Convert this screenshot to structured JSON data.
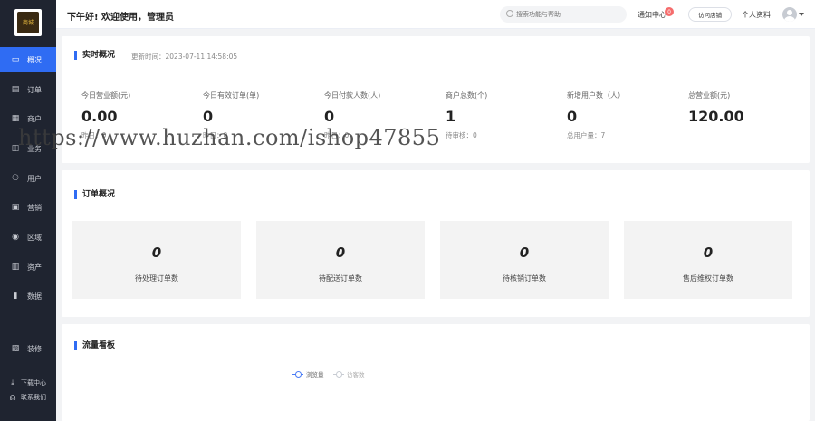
{
  "logo": {
    "text": "商城"
  },
  "sidebar": {
    "items": [
      {
        "label": "概况",
        "icon": "monitor-icon",
        "glyph": "▭"
      },
      {
        "label": "订单",
        "icon": "order-icon",
        "glyph": "▤"
      },
      {
        "label": "商户",
        "icon": "shop-icon",
        "glyph": "▦"
      },
      {
        "label": "业务",
        "icon": "business-icon",
        "glyph": "◫"
      },
      {
        "label": "用户",
        "icon": "user-icon",
        "glyph": "⚇"
      },
      {
        "label": "营销",
        "icon": "marketing-icon",
        "glyph": "▣"
      },
      {
        "label": "区域",
        "icon": "region-icon",
        "glyph": "◉"
      },
      {
        "label": "资产",
        "icon": "asset-icon",
        "glyph": "▥"
      },
      {
        "label": "数据",
        "icon": "data-icon",
        "glyph": "▮"
      },
      {
        "label": "装修",
        "icon": "decorate-icon",
        "glyph": "▧"
      }
    ],
    "footer": [
      {
        "label": "下载中心",
        "icon": "download-icon",
        "glyph": "⤓"
      },
      {
        "label": "联系我们",
        "icon": "headset-icon",
        "glyph": "☊"
      }
    ]
  },
  "header": {
    "greeting": "下午好! 欢迎使用，管理员",
    "search_placeholder": "搜索功能与帮助",
    "notice": "通知中心",
    "notice_count": "0",
    "visit_store": "访问店铺",
    "profile": "个人资料"
  },
  "realtime": {
    "title": "实时概况",
    "update_time": "更新时间：2023-07-11 14:58:05",
    "stats": [
      {
        "label": "今日营业额(元)",
        "value": "0.00",
        "sub": "昨日：0"
      },
      {
        "label": "今日有效订单(单)",
        "value": "0",
        "sub": "昨日：0"
      },
      {
        "label": "今日付款人数(人)",
        "value": "0",
        "sub": "昨日：0"
      },
      {
        "label": "商户总数(个)",
        "value": "1",
        "sub": "待审核：0"
      },
      {
        "label": "新增用户数（人）",
        "value": "0",
        "sub": "总用户量：7"
      },
      {
        "label": "总营业额(元)",
        "value": "120.00",
        "sub": ""
      }
    ]
  },
  "orders": {
    "title": "订单概况",
    "boxes": [
      {
        "value": "0",
        "label": "待处理订单数"
      },
      {
        "value": "0",
        "label": "待配送订单数"
      },
      {
        "value": "0",
        "label": "待核销订单数"
      },
      {
        "value": "0",
        "label": "售后维权订单数"
      }
    ]
  },
  "traffic": {
    "title": "流量看板",
    "legend": [
      {
        "label": "浏览量",
        "color": "#4a7cf5"
      },
      {
        "label": "访客数",
        "color": "#c8ccd3"
      }
    ]
  },
  "watermark": "https://www.huzhan.com/ishop47855",
  "colors": {
    "accent": "#2f6cf3",
    "sidebar": "#1f2430",
    "badge": "#f56c6c"
  }
}
